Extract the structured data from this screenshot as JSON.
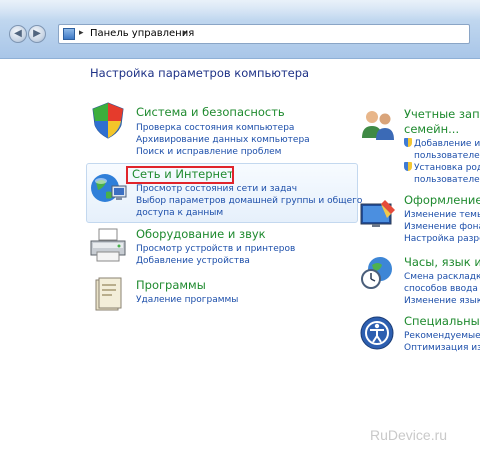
{
  "address_bar": {
    "separator": "▸",
    "breadcrumb": "Панель управления",
    "back_glyph": "◀",
    "forward_glyph": "▶"
  },
  "main": {
    "title": "Настройка параметров компьютера",
    "left_categories": [
      {
        "title": "Система и безопасность",
        "icon": "shield-flag-icon",
        "links": [
          "Проверка состояния компьютера",
          "Архивирование данных компьютера",
          "Поиск и исправление проблем"
        ]
      },
      {
        "title": "Сеть и Интернет",
        "icon": "globe-network-icon",
        "links": [
          "Просмотр состояния сети и задач",
          "Выбор параметров домашней группы и общего",
          "доступа к данным"
        ]
      },
      {
        "title": "Оборудование и звук",
        "icon": "printer-icon",
        "links": [
          "Просмотр устройств и принтеров",
          "Добавление устройства"
        ]
      },
      {
        "title": "Программы",
        "icon": "programs-icon",
        "links": [
          "Удаление программы"
        ]
      }
    ],
    "right_categories": [
      {
        "title": "Учетные запи",
        "title_line2": "семейн...",
        "icon": "users-icon",
        "links": [
          "Добавление и у",
          "пользователей",
          "Установка роди",
          "пользователей"
        ]
      },
      {
        "title": "Оформление",
        "icon": "display-icon",
        "links": [
          "Изменение темы",
          "Изменение фона р",
          "Настройка разреш"
        ]
      },
      {
        "title": "Часы, язык и ре",
        "icon": "clock-globe-icon",
        "links": [
          "Смена раскладки",
          "способов ввода",
          "Изменение языка"
        ]
      },
      {
        "title": "Специальные",
        "icon": "accessibility-icon",
        "links": [
          "Рекомендуемые W",
          "Оптимизация изоб"
        ]
      }
    ]
  },
  "watermark": "RuDevice.ru",
  "colors": {
    "category_title": "#1e8a2e",
    "link": "#1d4faa",
    "page_title": "#1e3287",
    "highlight_box": "#e0242b"
  }
}
